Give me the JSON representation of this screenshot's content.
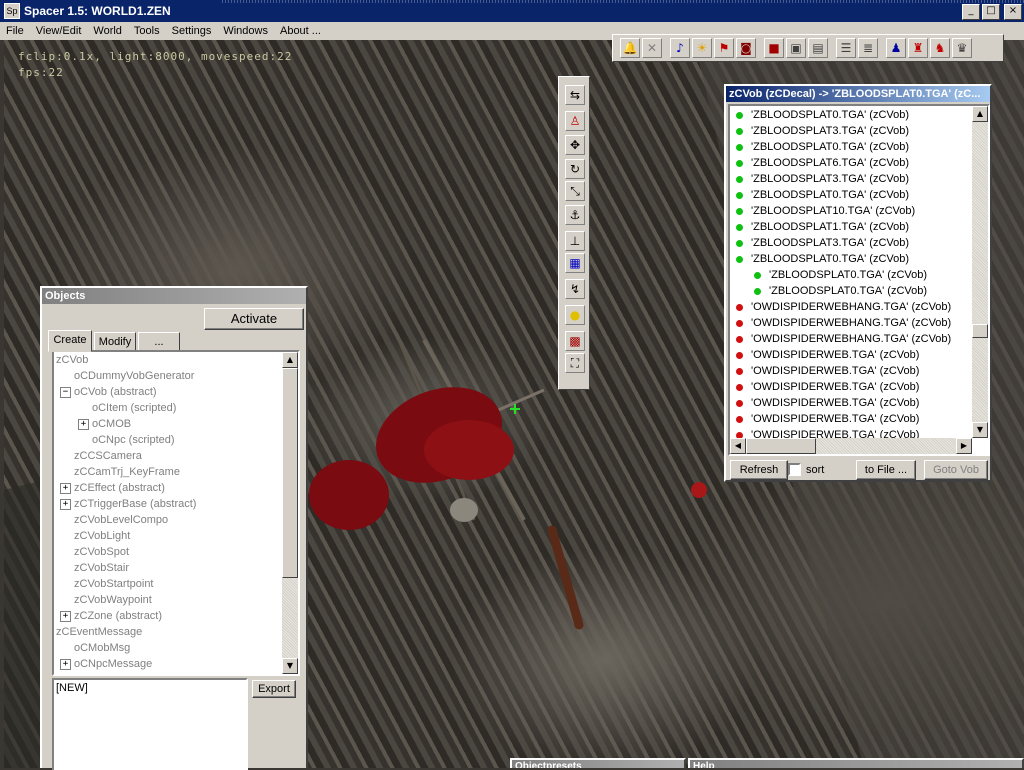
{
  "window": {
    "title": "Spacer 1.5: WORLD1.ZEN",
    "app_icon": "Sp"
  },
  "window_controls": {
    "minimize": "_",
    "maximize": "□",
    "close": "×"
  },
  "menu": [
    "File",
    "View/Edit",
    "World",
    "Tools",
    "Settings",
    "Windows",
    "About ..."
  ],
  "hud": {
    "line1": "fclip:0.1x, light:8000, movespeed:22",
    "line2": "fps:22"
  },
  "objects_panel": {
    "title": "Objects",
    "activate_label": "Activate",
    "tabs": [
      "Create",
      "Modify",
      "..."
    ],
    "active_tab": "Create",
    "tree": [
      {
        "label": "zCVob",
        "indent": 0,
        "expander": ""
      },
      {
        "label": "oCDummyVobGenerator",
        "indent": 1,
        "expander": ""
      },
      {
        "label": "oCVob (abstract)",
        "indent": 1,
        "expander": "−"
      },
      {
        "label": "oCItem (scripted)",
        "indent": 2,
        "expander": ""
      },
      {
        "label": "oCMOB",
        "indent": 2,
        "expander": "+"
      },
      {
        "label": "oCNpc (scripted)",
        "indent": 2,
        "expander": ""
      },
      {
        "label": "zCCSCamera",
        "indent": 1,
        "expander": ""
      },
      {
        "label": "zCCamTrj_KeyFrame",
        "indent": 1,
        "expander": ""
      },
      {
        "label": "zCEffect (abstract)",
        "indent": 1,
        "expander": "+"
      },
      {
        "label": "zCTriggerBase (abstract)",
        "indent": 1,
        "expander": "+"
      },
      {
        "label": "zCVobLevelCompo",
        "indent": 1,
        "expander": ""
      },
      {
        "label": "zCVobLight",
        "indent": 1,
        "expander": ""
      },
      {
        "label": "zCVobSpot",
        "indent": 1,
        "expander": ""
      },
      {
        "label": "zCVobStair",
        "indent": 1,
        "expander": ""
      },
      {
        "label": "zCVobStartpoint",
        "indent": 1,
        "expander": ""
      },
      {
        "label": "zCVobWaypoint",
        "indent": 1,
        "expander": ""
      },
      {
        "label": "zCZone (abstract)",
        "indent": 1,
        "expander": "+"
      },
      {
        "label": "zCEventMessage",
        "indent": 0,
        "expander": ""
      },
      {
        "label": "oCMobMsg",
        "indent": 1,
        "expander": ""
      },
      {
        "label": "oCNpcMessage",
        "indent": 1,
        "expander": "+"
      }
    ],
    "preset_text": "[NEW]",
    "export_label": "Export"
  },
  "vob_list": {
    "title": "zCVob (zCDecal) -> 'ZBLOODSPLAT0.TGA' (zC...",
    "items": [
      {
        "label": "'ZBLOODSPLAT0.TGA' (zCVob)",
        "color": "#10c010",
        "indent": 0
      },
      {
        "label": "'ZBLOODSPLAT3.TGA' (zCVob)",
        "color": "#10c010",
        "indent": 0
      },
      {
        "label": "'ZBLOODSPLAT0.TGA' (zCVob)",
        "color": "#10c010",
        "indent": 0
      },
      {
        "label": "'ZBLOODSPLAT6.TGA' (zCVob)",
        "color": "#10c010",
        "indent": 0
      },
      {
        "label": "'ZBLOODSPLAT3.TGA' (zCVob)",
        "color": "#10c010",
        "indent": 0
      },
      {
        "label": "'ZBLOODSPLAT0.TGA' (zCVob)",
        "color": "#10c010",
        "indent": 0
      },
      {
        "label": "'ZBLOODSPLAT10.TGA' (zCVob)",
        "color": "#10c010",
        "indent": 0
      },
      {
        "label": "'ZBLOODSPLAT1.TGA' (zCVob)",
        "color": "#10c010",
        "indent": 0
      },
      {
        "label": "'ZBLOODSPLAT3.TGA' (zCVob)",
        "color": "#10c010",
        "indent": 0
      },
      {
        "label": "'ZBLOODSPLAT0.TGA' (zCVob)",
        "color": "#10c010",
        "indent": 0
      },
      {
        "label": "'ZBLOODSPLAT0.TGA' (zCVob)",
        "color": "#10c010",
        "indent": 1
      },
      {
        "label": "'ZBLOODSPLAT0.TGA' (zCVob)",
        "color": "#10c010",
        "indent": 1
      },
      {
        "label": "'OWDISPIDERWEBHANG.TGA' (zCVob)",
        "color": "#d01010",
        "indent": 0
      },
      {
        "label": "'OWDISPIDERWEBHANG.TGA' (zCVob)",
        "color": "#d01010",
        "indent": 0
      },
      {
        "label": "'OWDISPIDERWEBHANG.TGA' (zCVob)",
        "color": "#d01010",
        "indent": 0
      },
      {
        "label": "'OWDISPIDERWEB.TGA' (zCVob)",
        "color": "#d01010",
        "indent": 0
      },
      {
        "label": "'OWDISPIDERWEB.TGA' (zCVob)",
        "color": "#d01010",
        "indent": 0
      },
      {
        "label": "'OWDISPIDERWEB.TGA' (zCVob)",
        "color": "#d01010",
        "indent": 0
      },
      {
        "label": "'OWDISPIDERWEB.TGA' (zCVob)",
        "color": "#d01010",
        "indent": 0
      },
      {
        "label": "'OWDISPIDERWEB.TGA' (zCVob)",
        "color": "#d01010",
        "indent": 0
      },
      {
        "label": "'OWDISPIDERWEB.TGA' (zCVob)",
        "color": "#d01010",
        "indent": 0
      }
    ],
    "refresh_label": "Refresh",
    "sort_label": "sort",
    "tofile_label": "to File ...",
    "gotovob_label": "Goto Vob"
  },
  "top_toolbar_icons": [
    "bell-icon",
    "needle-icon",
    "note-icon",
    "sun-icon",
    "flag-icon",
    "camera-icon",
    "red-cube-icon",
    "cubes-icon",
    "document-icon",
    "list-icon",
    "move-icon",
    "tool-a-icon",
    "tool-b-icon",
    "tool-c-icon"
  ],
  "vertical_toolbar_icons": [
    "arrows-icon",
    "person-icon",
    "move-cross-icon",
    "rotate-icon",
    "scale-icon",
    "anchor-icon",
    "align-icon",
    "texture-icon",
    "link-icon",
    "bulb-icon",
    "tv-icon",
    "camera-icon"
  ],
  "bottom_windows": {
    "left": "Objectpresets",
    "right": "Help"
  }
}
